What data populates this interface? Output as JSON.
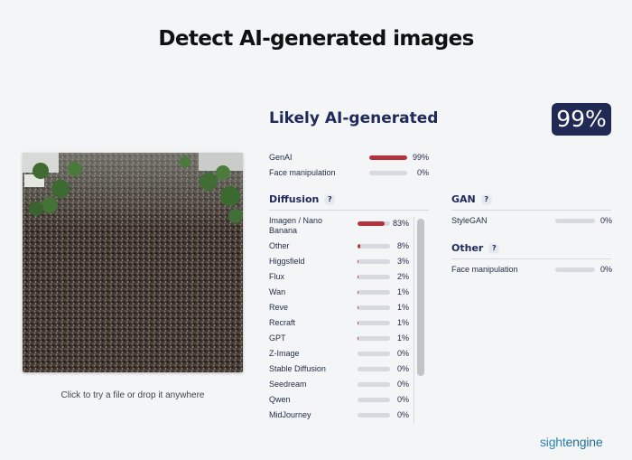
{
  "page": {
    "title": "Detect AI-generated images"
  },
  "upload": {
    "hint": "Click to try a file or drop it anywhere"
  },
  "result": {
    "verdict": "Likely AI-generated",
    "score": "99%",
    "summary": [
      {
        "label": "GenAI",
        "pct": "99%",
        "value": 0.99
      },
      {
        "label": "Face manipulation",
        "pct": "0%",
        "value": 0.0
      }
    ]
  },
  "diffusion": {
    "title": "Diffusion",
    "help": "?",
    "items": [
      {
        "label": "Imagen / Nano",
        "label2": "Banana",
        "pct": "83%",
        "value": 0.83
      },
      {
        "label": "Other",
        "pct": "8%",
        "value": 0.08
      },
      {
        "label": "Higgsfield",
        "pct": "3%",
        "value": 0.03
      },
      {
        "label": "Flux",
        "pct": "2%",
        "value": 0.02
      },
      {
        "label": "Wan",
        "pct": "1%",
        "value": 0.01
      },
      {
        "label": "Reve",
        "pct": "1%",
        "value": 0.01
      },
      {
        "label": "Recraft",
        "pct": "1%",
        "value": 0.01
      },
      {
        "label": "GPT",
        "pct": "1%",
        "value": 0.01
      },
      {
        "label": "Z-Image",
        "pct": "0%",
        "value": 0.0
      },
      {
        "label": "Stable Diffusion",
        "pct": "0%",
        "value": 0.0
      },
      {
        "label": "Seedream",
        "pct": "0%",
        "value": 0.0
      },
      {
        "label": "Qwen",
        "pct": "0%",
        "value": 0.0
      },
      {
        "label": "MidJourney",
        "pct": "0%",
        "value": 0.0
      }
    ]
  },
  "gan": {
    "title": "GAN",
    "help": "?",
    "items": [
      {
        "label": "StyleGAN",
        "pct": "0%",
        "value": 0.0
      }
    ]
  },
  "other": {
    "title": "Other",
    "help": "?",
    "items": [
      {
        "label": "Face manipulation",
        "pct": "0%",
        "value": 0.0
      }
    ]
  },
  "brand": {
    "part1": "sight",
    "part2": "engine"
  },
  "colors": {
    "accent": "#212a55",
    "bar_fill": "#b3323c",
    "bar_track": "#d6d9de",
    "brand": "#2e86b7"
  }
}
